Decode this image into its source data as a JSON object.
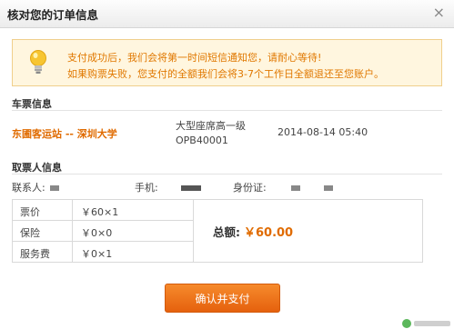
{
  "dialog": {
    "title": "核对您的订单信息",
    "close_label": "×"
  },
  "notice": {
    "line1": "支付成功后，我们会将第一时间短信通知您，请耐心等待!",
    "line2": "如果购票失败，您支付的全额我们会将3-7个工作日全额退还至您账户。"
  },
  "ticket": {
    "section_title": "车票信息",
    "route": "东圃客运站 -- 深圳大学",
    "seat_type": "大型座席高一级",
    "train_no": "OPB40001",
    "datetime": "2014-08-14 05:40"
  },
  "passenger": {
    "section_title": "取票人信息",
    "contact_label": "联系人:",
    "phone_label": "手机:",
    "id_label": "身份证:"
  },
  "fees": {
    "rows": [
      {
        "label": "票价",
        "value": "￥60×1"
      },
      {
        "label": "保险",
        "value": "￥0×0"
      },
      {
        "label": "服务费",
        "value": "￥0×1"
      }
    ],
    "total_label": "总额:",
    "total_value": "￥60.00"
  },
  "actions": {
    "confirm_pay": "确认并支付"
  },
  "colors": {
    "accent": "#e06b00",
    "notice_bg": "#fff6df",
    "button": "#ee7420"
  }
}
